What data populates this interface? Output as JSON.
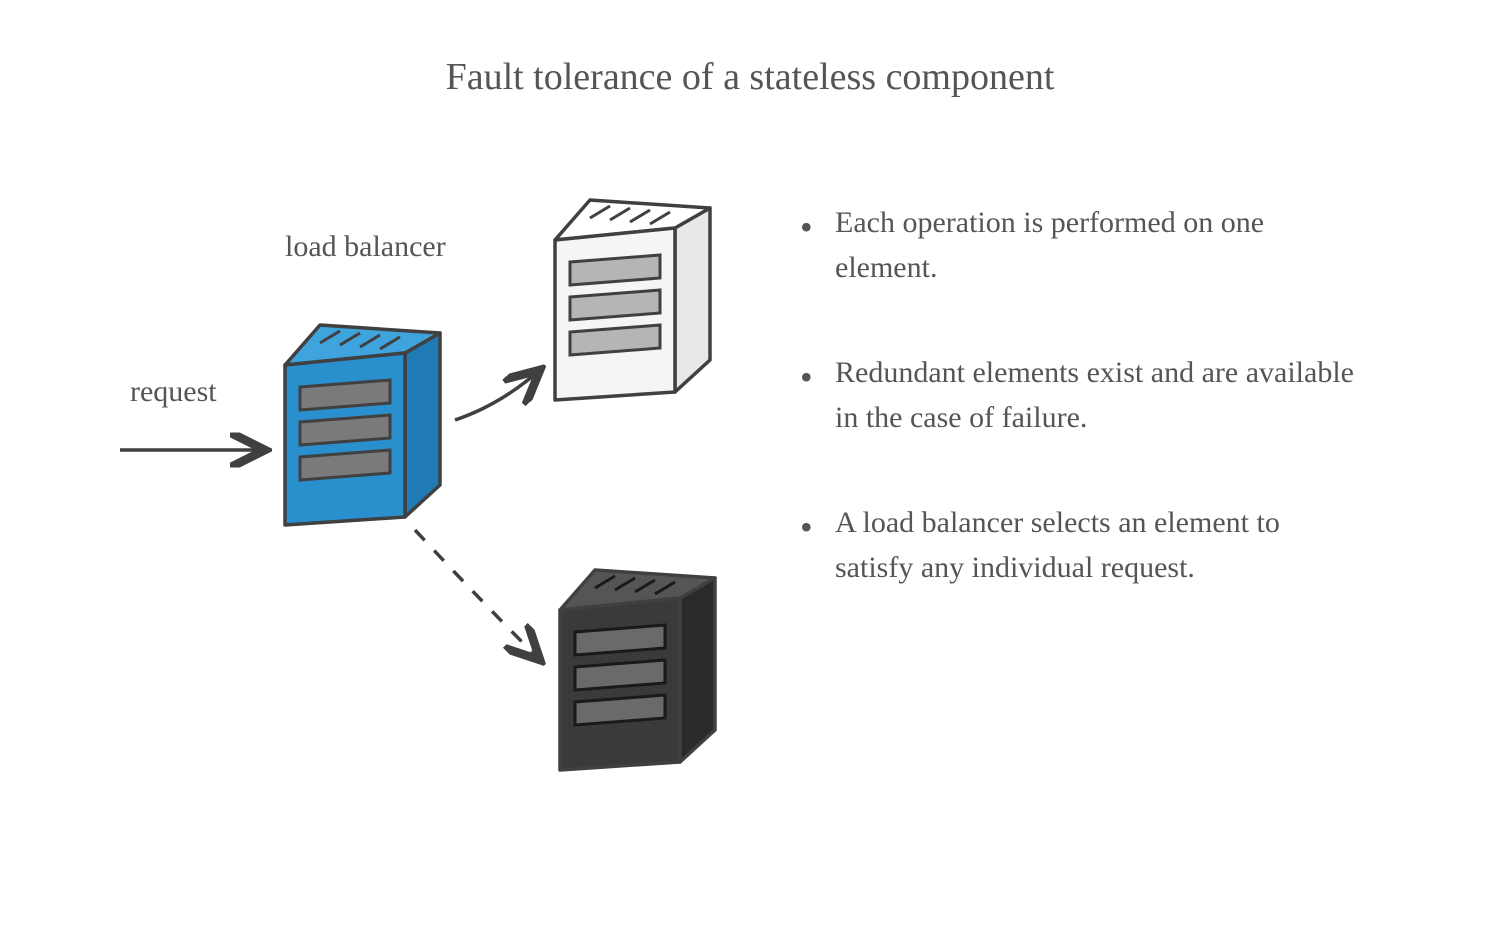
{
  "title": "Fault tolerance of a stateless component",
  "labels": {
    "load_balancer": "load balancer",
    "request": "request"
  },
  "bullets": [
    "Each operation is performed on one element.",
    "Redundant elements exist and are available in the case of failure.",
    "A load balancer selects an element to satisfy any individual request."
  ],
  "colors": {
    "load_balancer_server": "#2a8fcd",
    "server_white": "#f5f5f5",
    "server_black": "#3a3a3a",
    "stroke": "#404040",
    "slot": "#7a7a7a"
  }
}
